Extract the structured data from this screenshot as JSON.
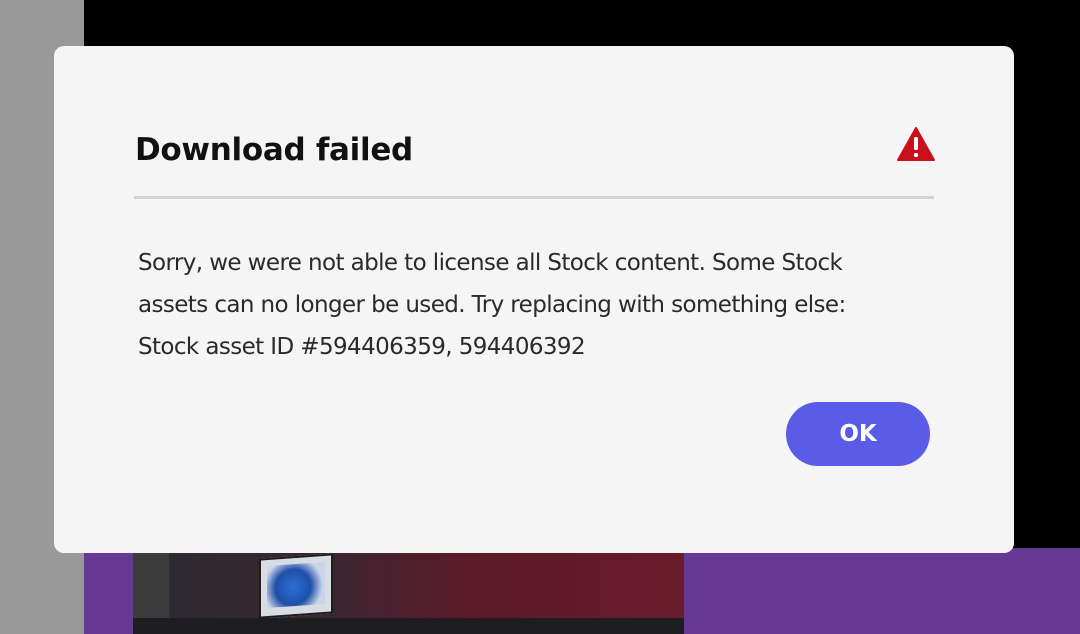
{
  "dialog": {
    "title": "Download failed",
    "icon": "warning-icon",
    "message": "Sorry, we were not able to license all Stock content. Some Stock assets can no longer be used. Try replacing with something else: Stock asset ID #594406359, 594406392",
    "ok_label": "OK"
  },
  "colors": {
    "dialog_background": "#f5f5f5",
    "primary_button": "#5a5be6",
    "warning": "#c9101a",
    "backdrop_purple": "#663a93"
  }
}
